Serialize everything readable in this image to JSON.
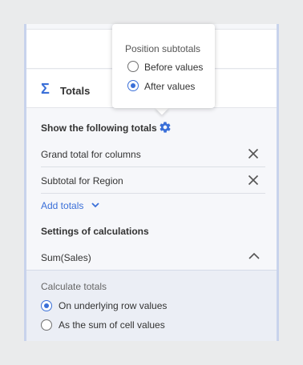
{
  "totals_section": {
    "title": "Totals",
    "show_following_label": "Show the following totals",
    "items": [
      {
        "label": "Grand total for columns"
      },
      {
        "label": "Subtotal for Region"
      }
    ],
    "add_totals_label": "Add totals"
  },
  "calculations": {
    "title": "Settings of calculations",
    "measure": "Sum(Sales)",
    "calc_label": "Calculate totals",
    "options": [
      {
        "label": "On underlying row values",
        "selected": true
      },
      {
        "label": "As the sum of cell values",
        "selected": false
      }
    ]
  },
  "popover": {
    "title": "Position subtotals",
    "options": [
      {
        "label": "Before values",
        "selected": false
      },
      {
        "label": "After values",
        "selected": true
      }
    ]
  },
  "icons": {
    "sigma": "sigma-icon",
    "gear": "gear-icon",
    "close": "close-icon",
    "chevron_down": "chevron-down-icon",
    "chevron_up": "chevron-up-icon"
  },
  "colors": {
    "accent": "#3a6fd8",
    "panel_bg": "#f6f7fa",
    "calc_bg": "#ebeef5"
  }
}
